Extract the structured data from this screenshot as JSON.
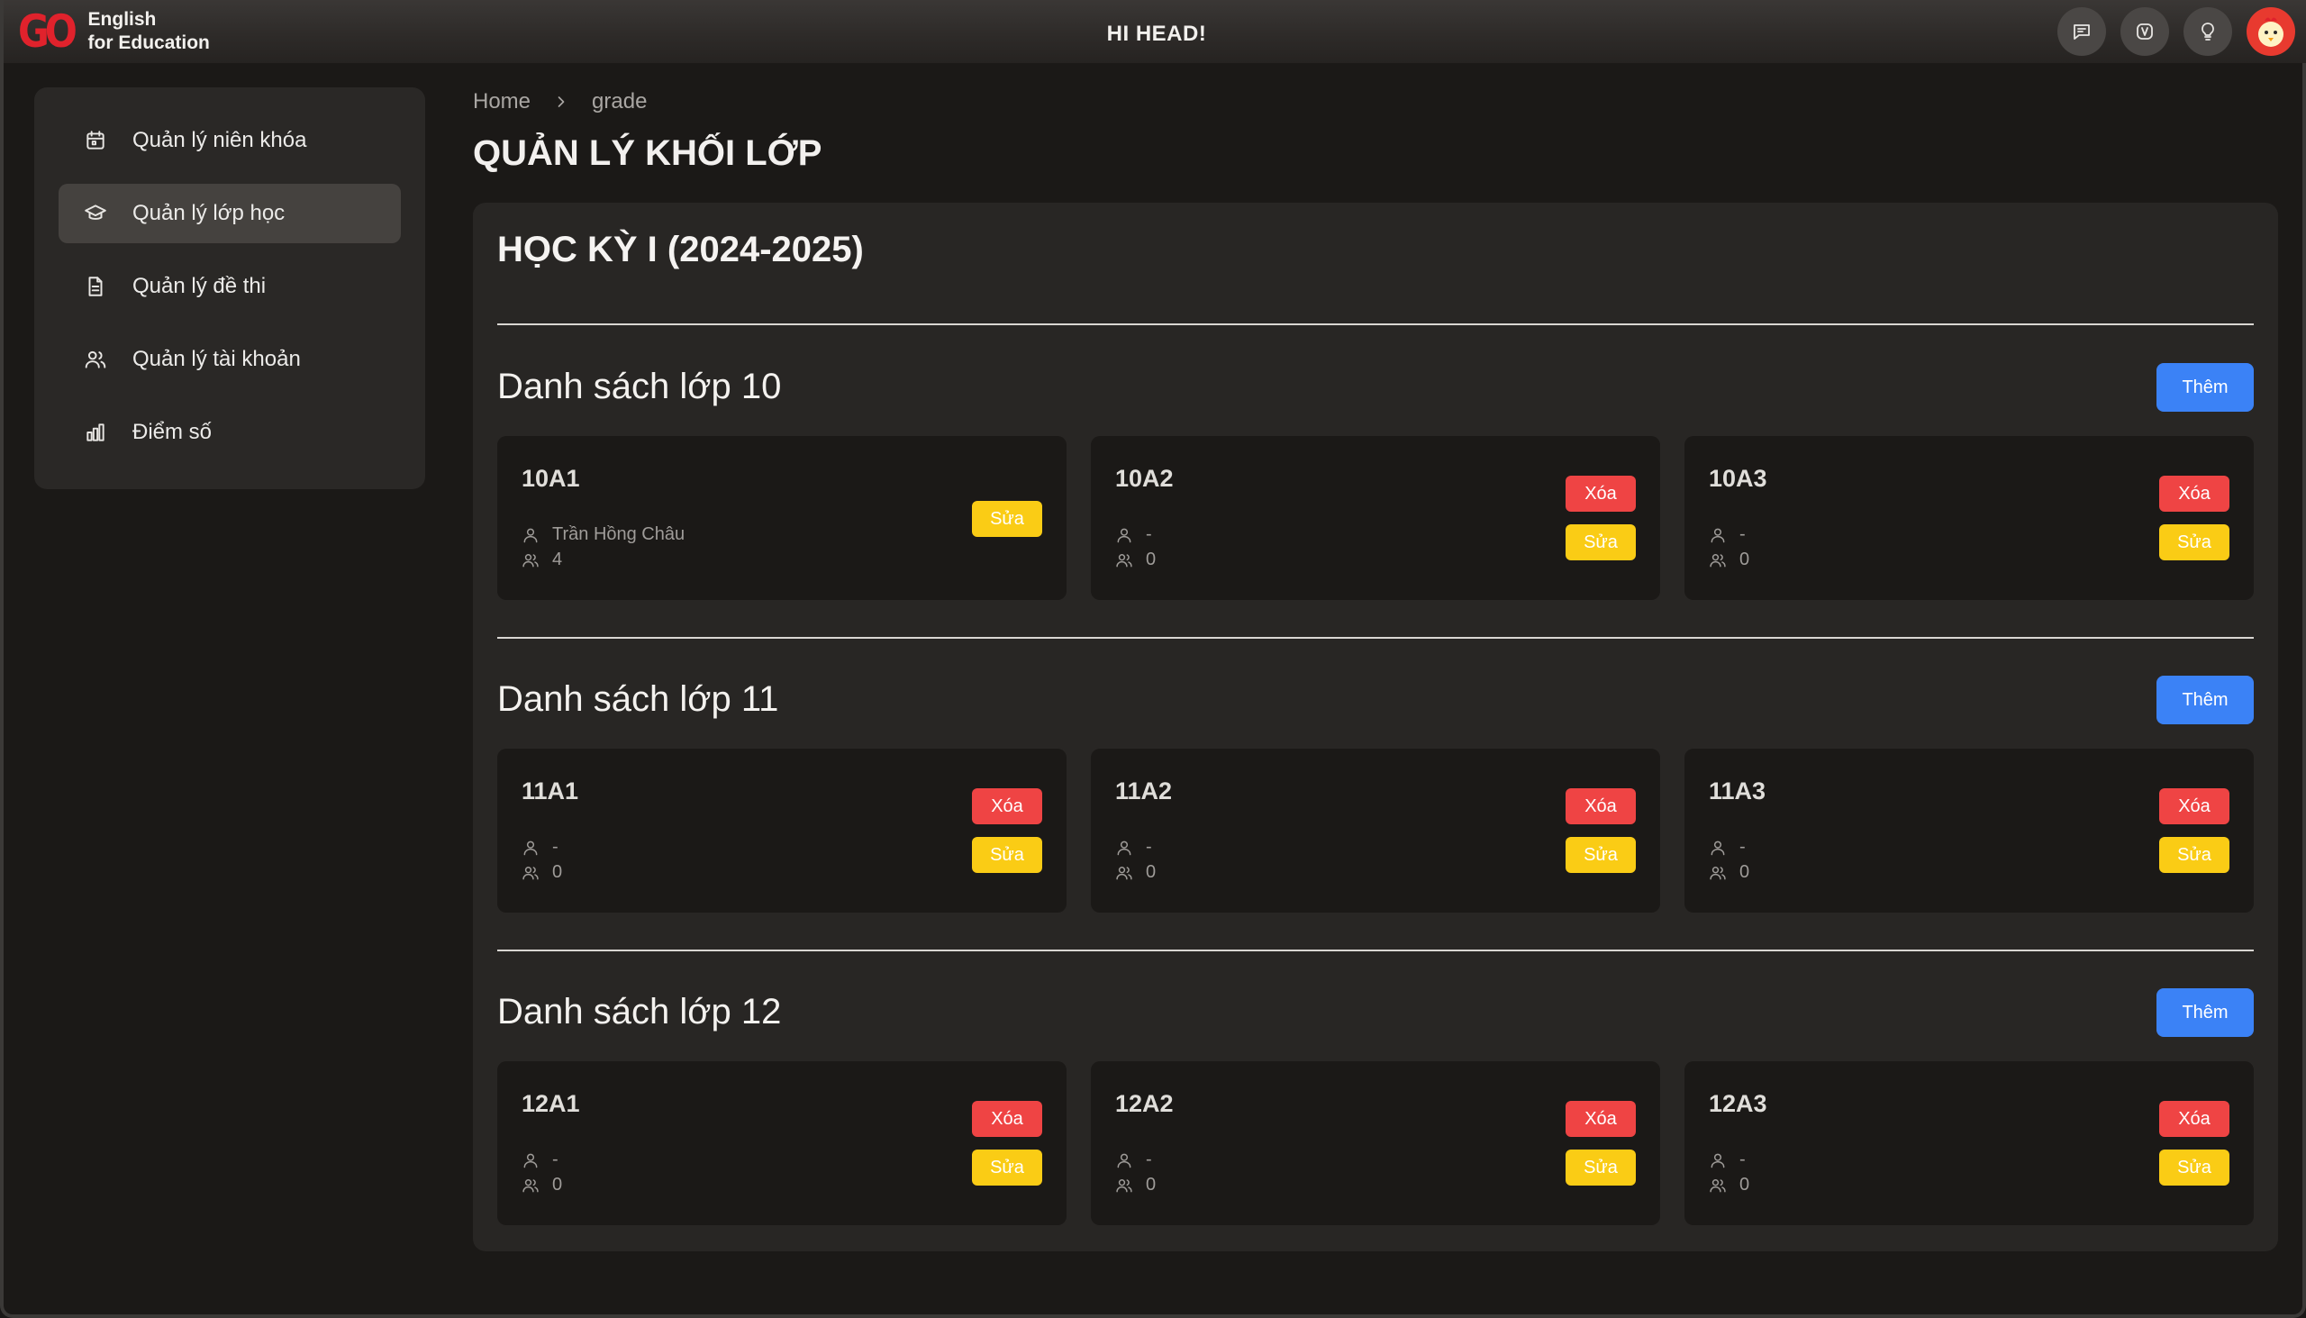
{
  "header": {
    "logo_mark": "GO",
    "logo_line1": "English",
    "logo_line2": "for Education",
    "greeting": "HI HEAD!",
    "icons": [
      "chat-icon",
      "v-badge-icon",
      "lightbulb-icon",
      "avatar"
    ]
  },
  "sidebar": {
    "items": [
      {
        "label": "Quản lý niên khóa",
        "icon": "calendar-icon",
        "active": false
      },
      {
        "label": "Quản lý lớp học",
        "icon": "graduation-cap-icon",
        "active": true
      },
      {
        "label": "Quản lý đề thi",
        "icon": "document-icon",
        "active": false
      },
      {
        "label": "Quản lý tài khoản",
        "icon": "users-icon",
        "active": false
      },
      {
        "label": "Điểm số",
        "icon": "bar-chart-icon",
        "active": false
      }
    ]
  },
  "breadcrumb": {
    "home": "Home",
    "current": "grade"
  },
  "page_title": "QUẢN LÝ KHỐI LỚP",
  "term_title": "HỌC KỲ I (2024-2025)",
  "buttons": {
    "add": "Thêm",
    "delete": "Xóa",
    "edit": "Sửa"
  },
  "colors": {
    "accent": "#3b82f6",
    "danger": "#ef4444",
    "warning": "#facc15"
  },
  "grades": [
    {
      "title": "Danh sách lớp 10",
      "classes": [
        {
          "name": "10A1",
          "teacher": "Trần Hồng Châu",
          "students": "4",
          "deletable": false
        },
        {
          "name": "10A2",
          "teacher": "-",
          "students": "0",
          "deletable": true
        },
        {
          "name": "10A3",
          "teacher": "-",
          "students": "0",
          "deletable": true
        }
      ]
    },
    {
      "title": "Danh sách lớp 11",
      "classes": [
        {
          "name": "11A1",
          "teacher": "-",
          "students": "0",
          "deletable": true
        },
        {
          "name": "11A2",
          "teacher": "-",
          "students": "0",
          "deletable": true
        },
        {
          "name": "11A3",
          "teacher": "-",
          "students": "0",
          "deletable": true
        }
      ]
    },
    {
      "title": "Danh sách lớp 12",
      "classes": [
        {
          "name": "12A1",
          "teacher": "-",
          "students": "0",
          "deletable": true
        },
        {
          "name": "12A2",
          "teacher": "-",
          "students": "0",
          "deletable": true
        },
        {
          "name": "12A3",
          "teacher": "-",
          "students": "0",
          "deletable": true
        }
      ]
    }
  ]
}
